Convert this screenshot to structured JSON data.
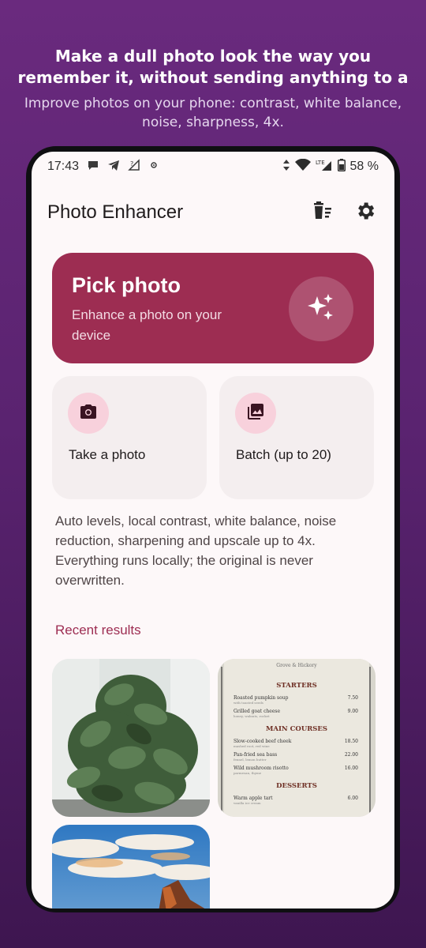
{
  "promo": {
    "headline": "Make a dull photo look the way you\nremember it, without sending anything to a",
    "subheadline": "Improve photos on your phone: contrast, white balance, noise, sharpness, 4x."
  },
  "status_bar": {
    "time": "17:43",
    "battery": "58 %",
    "network": "LTE"
  },
  "app_bar": {
    "title": "Photo Enhancer",
    "icons": [
      "delete-list-icon",
      "gear-icon"
    ]
  },
  "pick_card": {
    "title": "Pick photo",
    "subtitle": "Enhance a photo on your device",
    "icon": "sparkles-icon"
  },
  "actions": [
    {
      "label": "Take a photo",
      "icon": "camera-icon"
    },
    {
      "label": "Batch (up to 20)",
      "icon": "photo-library-icon"
    }
  ],
  "description": "Auto levels, local contrast, white balance, noise reduction, sharpening and upscale up to 4x. Everything runs locally; the original is never overwritten.",
  "recent": {
    "title": "Recent results",
    "menu_thumbnail": {
      "header": "Grove & Hickory",
      "sections": [
        {
          "title": "STARTERS",
          "items": [
            {
              "name": "Roasted pumpkin soup",
              "note": "with toasted seeds",
              "price": "7.50"
            },
            {
              "name": "Grilled goat cheese",
              "note": "honey, walnuts, rocket",
              "price": "9.00"
            }
          ]
        },
        {
          "title": "MAIN COURSES",
          "items": [
            {
              "name": "Slow-cooked beef cheek",
              "note": "mashed root, red wine",
              "price": "18.50"
            },
            {
              "name": "Pan-fried sea bass",
              "note": "fennel, lemon butter",
              "price": "22.00"
            },
            {
              "name": "Wild mushroom risotto",
              "note": "parmesan, thyme",
              "price": "16.00"
            }
          ]
        },
        {
          "title": "DESSERTS",
          "items": [
            {
              "name": "Warm apple tart",
              "note": "vanilla ice cream",
              "price": "6.00"
            }
          ]
        }
      ]
    }
  },
  "colors": {
    "accent": "#9d2d52",
    "icon_bg": "#f8d1dc",
    "card_bg": "#f4eeef",
    "background": "#fdf8f9"
  }
}
